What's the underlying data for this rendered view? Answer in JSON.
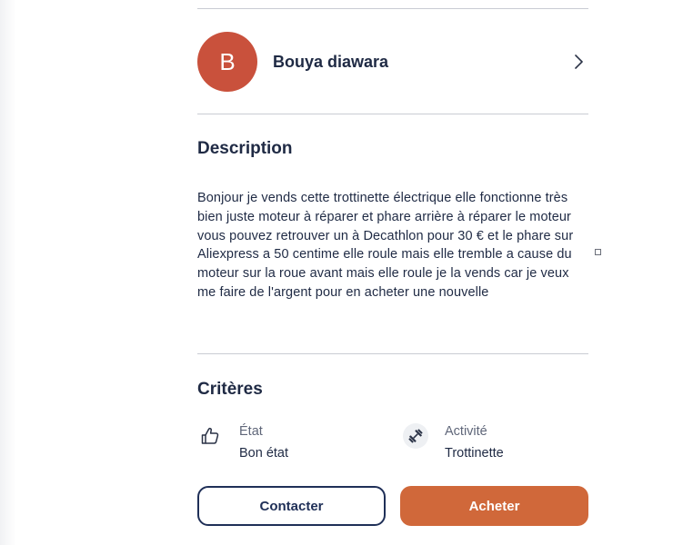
{
  "seller": {
    "initial": "B",
    "name": "Bouya diawara",
    "avatar_color": "#c9513c"
  },
  "description": {
    "title": "Description",
    "text": "Bonjour je vends cette trottinette électrique elle fonctionne très bien juste moteur à réparer et phare arrière à réparer le moteur vous pouvez retrouver un à Decathlon pour 30 € et le phare sur Aliexpress a 50 centime elle roule mais elle tremble a cause du moteur sur la roue avant mais elle roule je la vends car je veux me faire de l'argent pour en acheter une nouvelle"
  },
  "criteria": {
    "title": "Critères",
    "items": [
      {
        "label": "État",
        "value": "Bon état",
        "icon": "thumbs-up-icon"
      },
      {
        "label": "Activité",
        "value": "Trottinette",
        "icon": "dumbbell-icon"
      }
    ]
  },
  "actions": {
    "contact_label": "Contacter",
    "buy_label": "Acheter",
    "buy_color": "#d0683a",
    "contact_color": "#1f2f57"
  }
}
